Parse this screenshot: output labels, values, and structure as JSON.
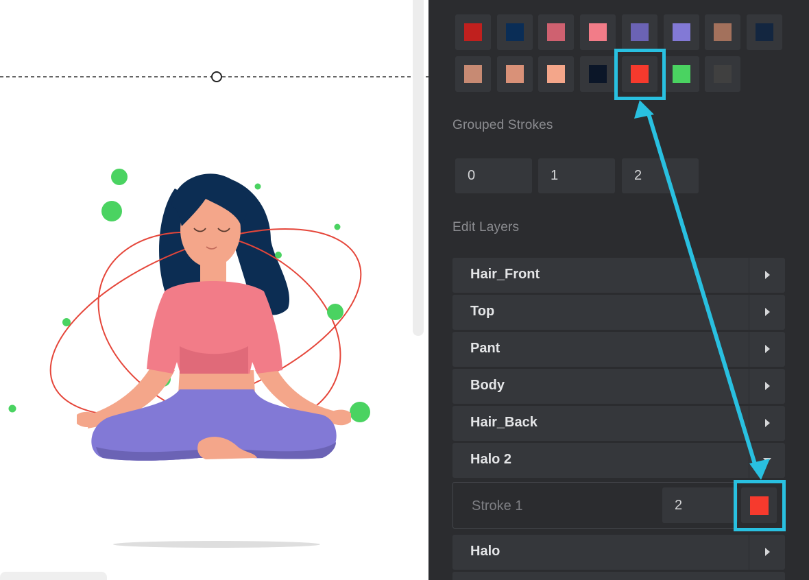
{
  "palette": {
    "row1": [
      {
        "color": "#c0201e",
        "name": "swatch-dark-red"
      },
      {
        "color": "#0a2d56",
        "name": "swatch-navy"
      },
      {
        "color": "#cf6170",
        "name": "swatch-rose"
      },
      {
        "color": "#f27c88",
        "name": "swatch-pink"
      },
      {
        "color": "#6b63b5",
        "name": "swatch-indigo"
      },
      {
        "color": "#8279d6",
        "name": "swatch-lavender"
      },
      {
        "color": "#a3715c",
        "name": "swatch-brown"
      },
      {
        "color": "#132640",
        "name": "swatch-dark-navy"
      }
    ],
    "row2": [
      {
        "color": "#c78a73",
        "name": "swatch-tan"
      },
      {
        "color": "#d99178",
        "name": "swatch-peach"
      },
      {
        "color": "#f4a68a",
        "name": "swatch-light-peach"
      },
      {
        "color": "#0b1628",
        "name": "swatch-black-blue"
      },
      {
        "color": "#f63a2d",
        "name": "swatch-red"
      },
      {
        "color": "#4ad361",
        "name": "swatch-green"
      },
      {
        "color": "#404040",
        "name": "swatch-gray"
      }
    ],
    "selected_color": "#f63a2d"
  },
  "grouped_strokes": {
    "title": "Grouped Strokes",
    "values": [
      "0",
      "1",
      "2"
    ]
  },
  "layers": {
    "title": "Edit Layers",
    "items": [
      {
        "label": "Hair_Front",
        "expanded": false
      },
      {
        "label": "Top",
        "expanded": false
      },
      {
        "label": "Pant",
        "expanded": false
      },
      {
        "label": "Body",
        "expanded": false
      },
      {
        "label": "Hair_Back",
        "expanded": false
      },
      {
        "label": "Halo 2",
        "expanded": true
      },
      {
        "label": "Halo",
        "expanded": false
      }
    ],
    "stroke": {
      "label": "Stroke 1",
      "width": "2",
      "color": "#f63a2d"
    }
  },
  "annotation": {
    "color": "#29c0e0"
  },
  "illustration": {
    "halo_color": "#e5463a",
    "dot_color": "#4ad361"
  }
}
